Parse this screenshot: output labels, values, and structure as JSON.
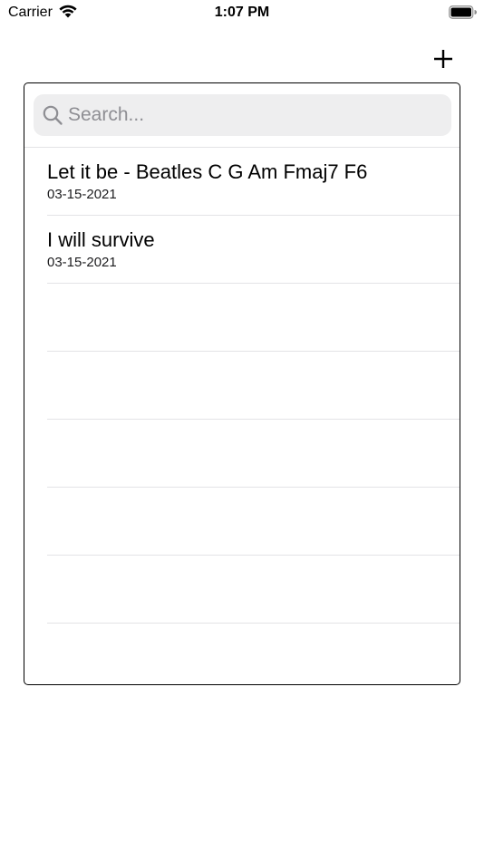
{
  "status_bar": {
    "carrier": "Carrier",
    "time": "1:07 PM"
  },
  "toolbar": {
    "add_icon": "plus-icon"
  },
  "search": {
    "placeholder": "Search...",
    "value": ""
  },
  "songs": [
    {
      "title": "Let it be - Beatles C G Am Fmaj7 F6",
      "date": "03-15-2021"
    },
    {
      "title": "I will survive",
      "date": "03-15-2021"
    }
  ],
  "colors": {
    "search_bg": "#eeeeef",
    "separator": "#e3e3e6",
    "placeholder": "#8e8e93"
  }
}
